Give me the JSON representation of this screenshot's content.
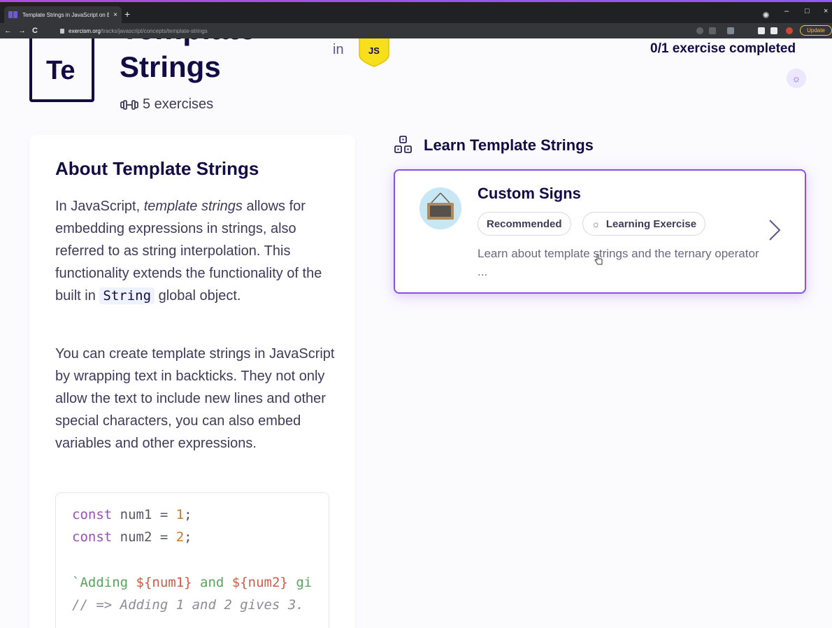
{
  "browser": {
    "tab_title": "Template Strings in JavaScript on Exercism",
    "tab_close": "×",
    "new_tab": "+",
    "back": "←",
    "forward": "→",
    "reload": "C",
    "url_host": "exercism.org",
    "url_path": "/tracks/javascript/concepts/template-strings",
    "update_label": "Update",
    "minimize": "–",
    "maximize": "□",
    "close": "×"
  },
  "header": {
    "logo_text": "Te",
    "title_partial": "Template",
    "title": "Strings",
    "exercise_count": "5 exercises",
    "in_label": "in",
    "track_badge": "JS",
    "completed": "0/1 exercise completed"
  },
  "about": {
    "title": "About Template Strings",
    "p1_a": "In JavaScript, ",
    "p1_em": "template strings",
    "p1_b": " allows for embedding expressions in strings, also referred to as string interpolation. This functionality extends the functionality of the built in ",
    "p1_code": "String",
    "p1_c": " global object.",
    "p2": "You can create template strings in JavaScript by wrapping text in backticks. They not only allow the text to include new lines and other special characters, you can also embed variables and other expressions.",
    "code": {
      "l1_kw": "const",
      "l1_rest": " num1 = ",
      "l1_num": "1",
      "l1_end": ";",
      "l2_kw": "const",
      "l2_rest": " num2 = ",
      "l2_num": "2",
      "l2_end": ";",
      "l3_a": "`Adding ",
      "l3_b": "${num1}",
      "l3_c": " and ",
      "l3_d": "${num2}",
      "l3_e": " gi",
      "l4": "// => Adding 1 and 2 gives 3."
    }
  },
  "learn": {
    "heading": "Learn Template Strings",
    "exercise": {
      "title": "Custom Signs",
      "tag_recommended": "Recommended",
      "tag_learning": "Learning Exercise",
      "description": "Learn about template strings and the ternary operator ..."
    }
  },
  "colors": {
    "brand_dark": "#130b43",
    "accent_purple": "#8e4de8",
    "js_yellow": "#f7df1e",
    "update_yellow": "#f3c24a"
  },
  "icons": [
    "lock-icon",
    "dumbbell-icon",
    "js-badge-icon",
    "theme-sun-icon",
    "concepts-icon",
    "custom-signs-icon",
    "bulb-icon",
    "chevron-right-icon",
    "cursor-hand-icon"
  ]
}
